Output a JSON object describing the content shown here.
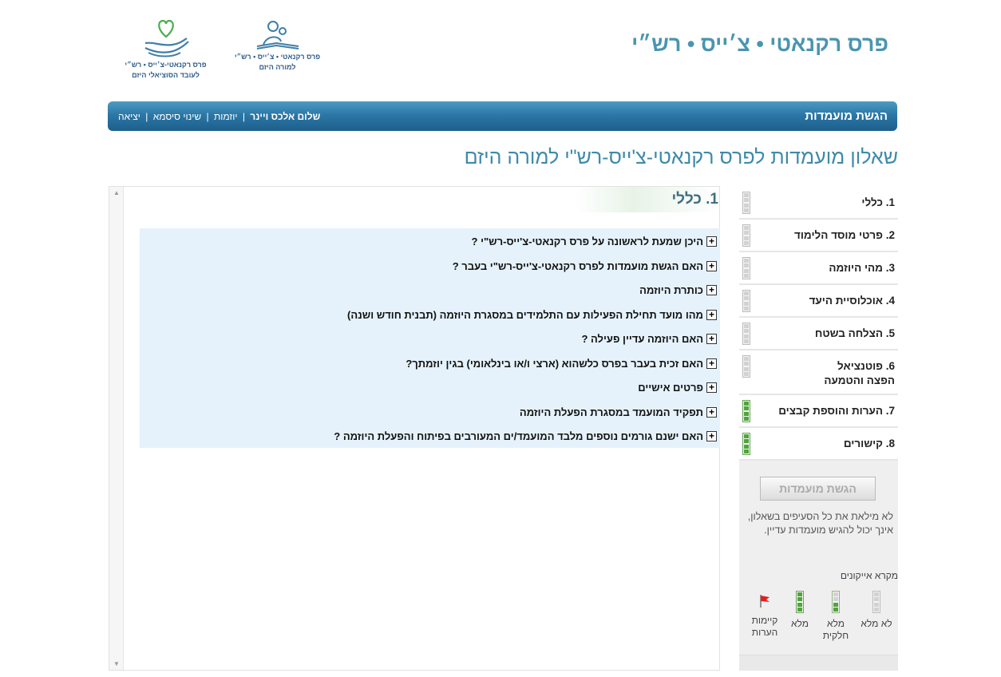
{
  "site": {
    "title": "פרס רקנאטי • צ׳ייס • רש״י",
    "logos": [
      {
        "text_line1": "פרס רקנאטי • צ׳ייס • רש״י",
        "text_line2": "למורה היזם",
        "icon": "teacher-icon"
      },
      {
        "text_line1": "פרס רקנאטי-צ׳ייס • רש״י",
        "text_line2": "לעובד הסוציאלי היזם",
        "icon": "heart-hands-icon"
      }
    ]
  },
  "navbar": {
    "title": "הגשת מועמדות",
    "user": "שלום אלכס ויינר",
    "links": [
      "יוזמות",
      "שינוי סיסמא",
      "יציאה"
    ],
    "separator": "|"
  },
  "page": {
    "title": "שאלון מועמדות לפרס רקנאטי-צ'ייס-רש\"י למורה היזם"
  },
  "sidebar": {
    "items": [
      {
        "label": "1. כללי",
        "status": "empty"
      },
      {
        "label": "2. פרטי מוסד הלימוד",
        "status": "empty"
      },
      {
        "label": "3. מהי היוזמה",
        "status": "empty"
      },
      {
        "label": "4. אוכלוסיית היעד",
        "status": "empty"
      },
      {
        "label": "5. הצלחה בשטח",
        "status": "empty"
      },
      {
        "label": "6. פוטנציאל הפצה והטמעה",
        "status": "empty"
      },
      {
        "label": "7. הערות והוספת קבצים",
        "status": "full"
      },
      {
        "label": "8. קישורים",
        "status": "full"
      }
    ],
    "submit_label": "הגשת מועמדות",
    "submit_note": "לא מילאת את כל הסעיפים בשאלון, אינך יכול להגיש מועמדות עדיין.",
    "legend_title": "מקרא אייקונים",
    "legend": [
      {
        "label": "לא מלא",
        "icon": "empty-status-icon"
      },
      {
        "label": "מלא חלקית",
        "icon": "partial-status-icon"
      },
      {
        "label": "מלא",
        "icon": "full-status-icon"
      },
      {
        "label": "קיימות הערות",
        "icon": "red-flag-icon"
      }
    ]
  },
  "content": {
    "section_title": "1. כללי",
    "expand_icon": "+",
    "questions": [
      "היכן שמעת לראשונה על פרס רקנאטי-צ'ייס-רש\"י ?",
      "האם הגשת מועמדות לפרס רקנאטי-צ'ייס-רש\"י בעבר ?",
      "כותרת היוזמה",
      "מהו מועד תחילת הפעילות עם התלמידים במסגרת היוזמה (תבנית חודש ושנה)",
      "האם היוזמה עדיין פעילה ?",
      "האם זכית בעבר בפרס כלשהוא (ארצי ו/או בינלאומי) בגין יוזמתך?",
      "פרטים אישיים",
      "תפקיד המועמד במסגרת הפעלת היוזמה",
      "האם ישנם גורמים נוספים מלבד המועמד/ים המעורבים בפיתוח והפעלת היוזמה ?"
    ]
  }
}
